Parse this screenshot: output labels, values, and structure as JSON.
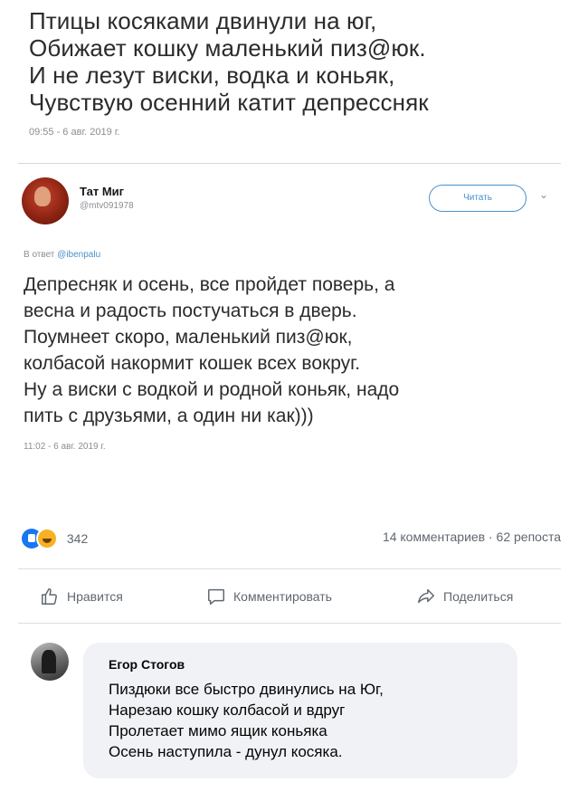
{
  "tweet": {
    "lines": [
      "Птицы косяками двинули на юг,",
      "Обижает кошку маленький пиз@юк.",
      "И не лезут виски, водка и коньяк,",
      "Чувствую осенний катит депрессняк"
    ],
    "date": "09:55 - 6 авг. 2019 г."
  },
  "reply_author": {
    "name": "Тат Миг",
    "handle": "@mtv091978",
    "follow_label": "Читать",
    "avatar_icon": "user-avatar-icon"
  },
  "reply": {
    "reply_prefix": "В ответ",
    "reply_mention": "@ibenpalu",
    "lines": [
      "Депресняк и осень, все пройдет поверь, а",
      "весна и радость постучаться в дверь.",
      "Поумнеет скоро, маленький пиз@юк,",
      "колбасой накормит кошек всех вокруг.",
      "Ну а виски с водкой и родной коньяк, надо",
      "пить с друзьями, а один ни как)))"
    ],
    "date": "11:02 - 6 авг. 2019 г."
  },
  "stats": {
    "reactions_count": "342",
    "comments_shares": "14 комментариев · 62 репоста"
  },
  "actions": {
    "like_label": "Нравится",
    "comment_label": "Комментировать",
    "share_label": "Поделиться"
  },
  "comment": {
    "author": "Егор Стогов",
    "lines": [
      "Пиздюки все быстро двинулись на Юг,",
      "Нарезаю кошку колбасой и вдруг",
      "Пролетает мимо ящик коньяка",
      "Осень наступила - дунул косяка."
    ]
  },
  "colors": {
    "accent": "#1877f2",
    "twitter_blue": "#4a90c9",
    "bubble_bg": "#f0f2f5"
  }
}
